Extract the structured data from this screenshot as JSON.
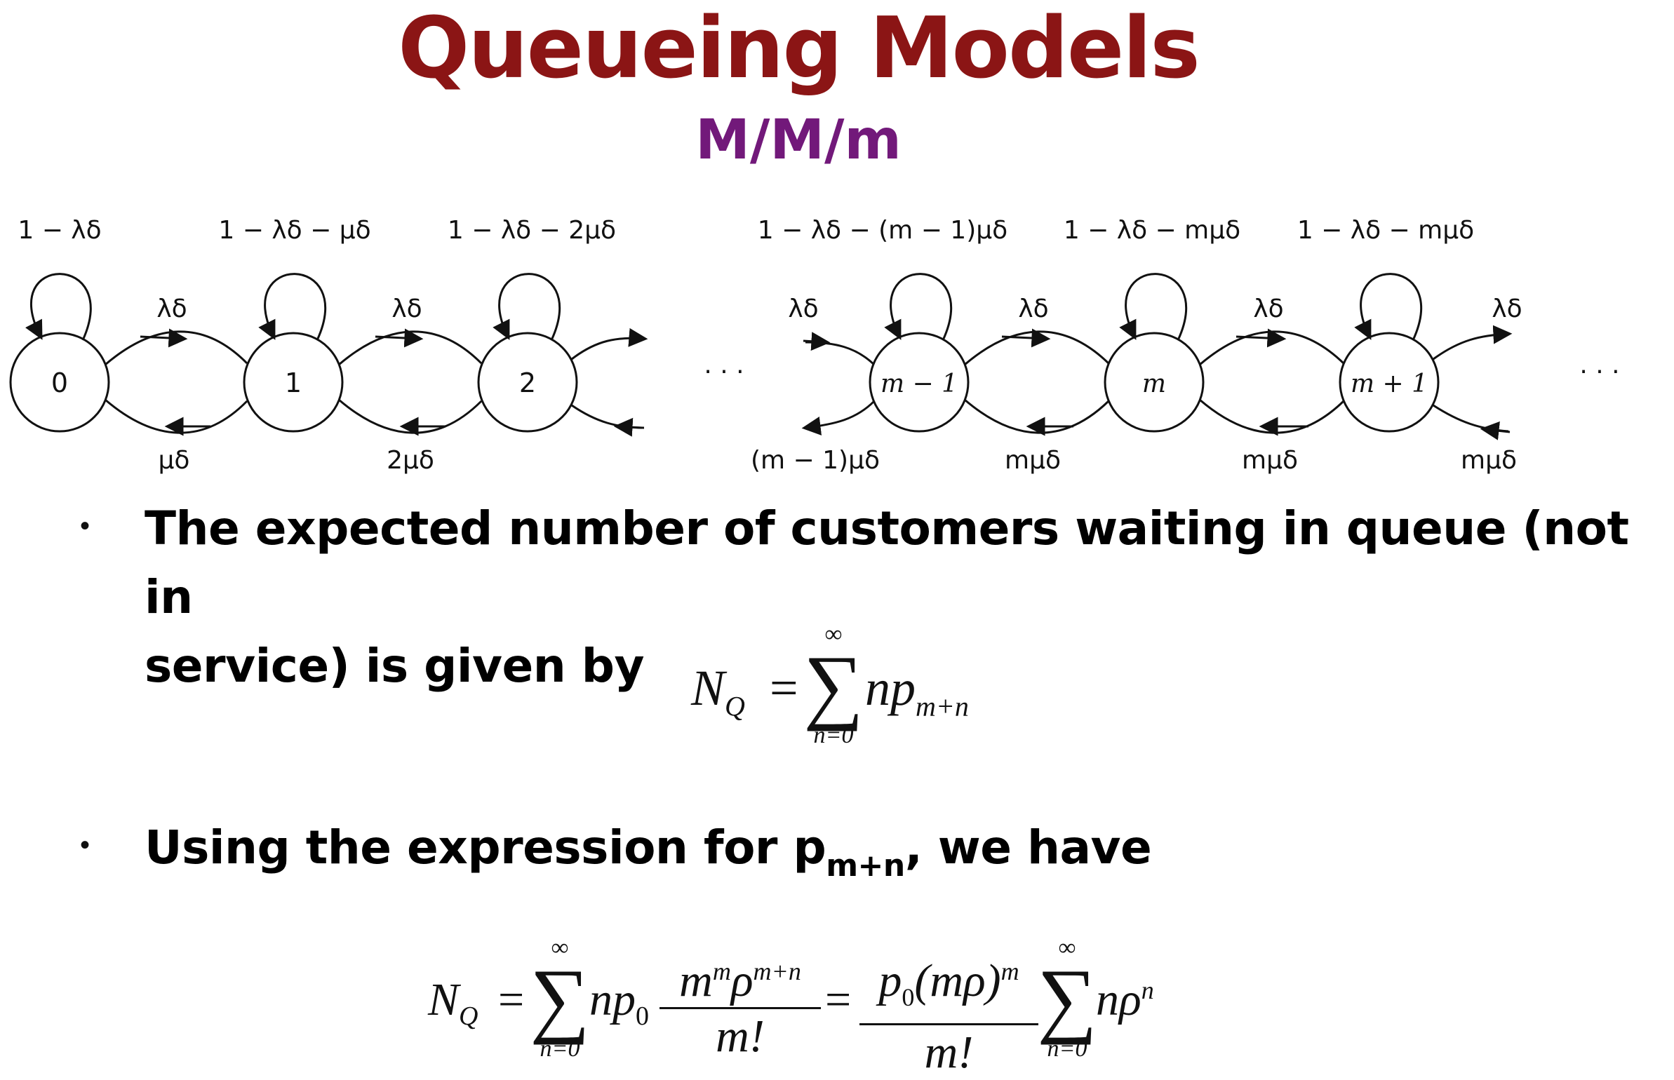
{
  "title": "Queueing Models",
  "subtitle": "M/M/m",
  "diagram": {
    "states_left": [
      "0",
      "1",
      "2"
    ],
    "states_right": [
      "m − 1",
      "m",
      "m + 1"
    ],
    "self_loops": [
      "1 − λδ",
      "1 − λδ − μδ",
      "1 − λδ − 2μδ",
      "1 − λδ − (m − 1)μδ",
      "1 − λδ − mμδ",
      "1 − λδ − mμδ"
    ],
    "arrival_labels": [
      "λδ",
      "λδ",
      "λδ",
      "λδ",
      "λδ",
      "λδ"
    ],
    "service_labels": [
      "μδ",
      "2μδ",
      "(m − 1)μδ",
      "mμδ",
      "mμδ",
      "mμδ"
    ],
    "ellipsis": "· · ·"
  },
  "bullets": [
    {
      "marker": "•",
      "line1": "The expected number of customers waiting in queue (not in",
      "line2": "service) is given by"
    },
    {
      "marker": "•",
      "prefix": "Using the expression for p",
      "subscript": "m+n",
      "suffix": ", we have"
    }
  ],
  "formula1": {
    "lhs": "N",
    "lhs_sub": "Q",
    "eq": "=",
    "sum_upper": "∞",
    "sum_lower": "n=0",
    "term": "np",
    "term_sub": "m+n"
  },
  "formula2": {
    "lhs": "N",
    "lhs_sub": "Q",
    "eq": "=",
    "sum_upper": "∞",
    "sum_lower": "n=0",
    "term1": "np",
    "term1_sub": "0",
    "frac1_num": "m",
    "frac1_num_sup": "m",
    "frac1_num_rho": "ρ",
    "frac1_num_rho_sup": "m+n",
    "frac1_den": "m!",
    "eq2": "=",
    "frac2_num": "p",
    "frac2_num_sub": "0",
    "frac2_num_rest": "(mρ)",
    "frac2_num_sup": "m",
    "frac2_den": "m!",
    "sum2_upper": "∞",
    "sum2_lower": "n=0",
    "term2": "nρ",
    "term2_sup": "n"
  }
}
